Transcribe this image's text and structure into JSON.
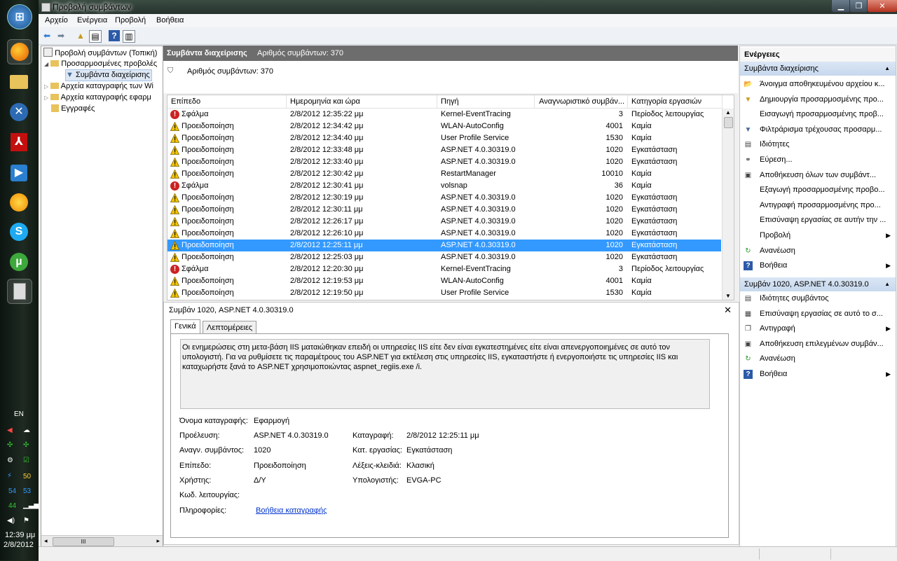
{
  "window": {
    "title": "Προβολή συμβάντων"
  },
  "menu": [
    "Αρχείο",
    "Ενέργεια",
    "Προβολή",
    "Βοήθεια"
  ],
  "tree": {
    "items": [
      {
        "label": "Προβολή συμβάντων (Τοπική)"
      },
      {
        "label": "Προσαρμοσμένες προβολές"
      },
      {
        "label": "Συμβάντα διαχείρισης"
      },
      {
        "label": "Αρχεία καταγραφής των Wi"
      },
      {
        "label": "Αρχεία καταγραφής εφαρμ"
      },
      {
        "label": "Εγγραφές"
      }
    ],
    "scroll_glyph": "III"
  },
  "center": {
    "header_title": "Συμβάντα διαχείρισης",
    "header_count": "Αριθμός συμβάντων: 370",
    "filter_count": "Αριθμός συμβάντων: 370",
    "columns": [
      "Επίπεδο",
      "Ημερομηνία και ώρα",
      "Πηγή",
      "Αναγνωριστικό συμβάν...",
      "Κατηγορία εργασιών"
    ],
    "rows": [
      {
        "level": "Σφάλμα",
        "type": "error",
        "date": "2/8/2012 12:35:22 μμ",
        "source": "Kernel-EventTracing",
        "id": "3",
        "category": "Περίοδος λειτουργίας"
      },
      {
        "level": "Προειδοποίηση",
        "type": "warning",
        "date": "2/8/2012 12:34:42 μμ",
        "source": "WLAN-AutoConfig",
        "id": "4001",
        "category": "Καμία"
      },
      {
        "level": "Προειδοποίηση",
        "type": "warning",
        "date": "2/8/2012 12:34:40 μμ",
        "source": "User Profile Service",
        "id": "1530",
        "category": "Καμία"
      },
      {
        "level": "Προειδοποίηση",
        "type": "warning",
        "date": "2/8/2012 12:33:48 μμ",
        "source": "ASP.NET 4.0.30319.0",
        "id": "1020",
        "category": "Εγκατάσταση"
      },
      {
        "level": "Προειδοποίηση",
        "type": "warning",
        "date": "2/8/2012 12:33:40 μμ",
        "source": "ASP.NET 4.0.30319.0",
        "id": "1020",
        "category": "Εγκατάσταση"
      },
      {
        "level": "Προειδοποίηση",
        "type": "warning",
        "date": "2/8/2012 12:30:42 μμ",
        "source": "RestartManager",
        "id": "10010",
        "category": "Καμία"
      },
      {
        "level": "Σφάλμα",
        "type": "error",
        "date": "2/8/2012 12:30:41 μμ",
        "source": "volsnap",
        "id": "36",
        "category": "Καμία"
      },
      {
        "level": "Προειδοποίηση",
        "type": "warning",
        "date": "2/8/2012 12:30:19 μμ",
        "source": "ASP.NET 4.0.30319.0",
        "id": "1020",
        "category": "Εγκατάσταση"
      },
      {
        "level": "Προειδοποίηση",
        "type": "warning",
        "date": "2/8/2012 12:30:11 μμ",
        "source": "ASP.NET 4.0.30319.0",
        "id": "1020",
        "category": "Εγκατάσταση"
      },
      {
        "level": "Προειδοποίηση",
        "type": "warning",
        "date": "2/8/2012 12:26:17 μμ",
        "source": "ASP.NET 4.0.30319.0",
        "id": "1020",
        "category": "Εγκατάσταση"
      },
      {
        "level": "Προειδοποίηση",
        "type": "warning",
        "date": "2/8/2012 12:26:10 μμ",
        "source": "ASP.NET 4.0.30319.0",
        "id": "1020",
        "category": "Εγκατάσταση"
      },
      {
        "level": "Προειδοποίηση",
        "type": "warning",
        "date": "2/8/2012 12:25:11 μμ",
        "source": "ASP.NET 4.0.30319.0",
        "id": "1020",
        "category": "Εγκατάσταση",
        "selected": true
      },
      {
        "level": "Προειδοποίηση",
        "type": "warning",
        "date": "2/8/2012 12:25:03 μμ",
        "source": "ASP.NET 4.0.30319.0",
        "id": "1020",
        "category": "Εγκατάσταση"
      },
      {
        "level": "Σφάλμα",
        "type": "error",
        "date": "2/8/2012 12:20:30 μμ",
        "source": "Kernel-EventTracing",
        "id": "3",
        "category": "Περίοδος λειτουργίας"
      },
      {
        "level": "Προειδοποίηση",
        "type": "warning",
        "date": "2/8/2012 12:19:53 μμ",
        "source": "WLAN-AutoConfig",
        "id": "4001",
        "category": "Καμία"
      },
      {
        "level": "Προειδοποίηση",
        "type": "warning",
        "date": "2/8/2012 12:19:50 μμ",
        "source": "User Profile Service",
        "id": "1530",
        "category": "Καμία"
      }
    ]
  },
  "detail": {
    "title": "Συμβάν 1020, ASP.NET 4.0.30319.0",
    "tabs": [
      "Γενικά",
      "Λεπτομέρειες"
    ],
    "description": "Οι ενημερώσεις στη μετα-βάση IIS ματαιώθηκαν επειδή οι υπηρεσίες IIS είτε δεν είναι εγκατεστημένες είτε είναι απενεργοποιημένες σε αυτό τον υπολογιστή. Για να ρυθμίσετε τις παραμέτρους του ASP.NET για εκτέλεση στις υπηρεσίες IIS, εγκαταστήστε ή ενεργοποιήστε τις υπηρεσίες IIS και καταχωρήστε ξανά το ASP.NET χρησιμοποιώντας aspnet_regiis.exe /i.",
    "fields": {
      "log_name_label": "Όνομα καταγραφής:",
      "log_name": "Εφαρμογή",
      "source_label": "Προέλευση:",
      "source": "ASP.NET 4.0.30319.0",
      "logged_label": "Καταγραφή:",
      "logged": "2/8/2012 12:25:11 μμ",
      "event_id_label": "Αναγν. συμβάντος:",
      "event_id": "1020",
      "task_label": "Κατ. εργασίας:",
      "task": "Εγκατάσταση",
      "level_label": "Επίπεδο:",
      "level": "Προειδοποίηση",
      "keywords_label": "Λέξεις-κλειδιά:",
      "keywords": "Κλασική",
      "user_label": "Χρήστης:",
      "user": "Δ/Υ",
      "computer_label": "Υπολογιστής:",
      "computer": "EVGA-PC",
      "opcode_label": "Κωδ. λειτουργίας:",
      "info_label": "Πληροφορίες:",
      "info_link": "Βοήθεια καταγραφής"
    }
  },
  "actions": {
    "header": "Ενέργειες",
    "section1": "Συμβάντα διαχείρισης",
    "items1": [
      {
        "label": "Άνοιγμα αποθηκευμένου αρχείου κ...",
        "icon": "open-folder-icon",
        "glyph": "📂"
      },
      {
        "label": "Δημιουργία προσαρμοσμένης προ...",
        "icon": "filter-create-icon",
        "glyph": "▼"
      },
      {
        "label": "Εισαγωγή προσαρμοσμένης προβ...",
        "icon": "",
        "glyph": ""
      },
      {
        "label": "Φιλτράρισμα τρέχουσας προσαρμ...",
        "icon": "filter-icon",
        "glyph": "▼"
      },
      {
        "label": "Ιδιότητες",
        "icon": "properties-icon",
        "glyph": "▤"
      },
      {
        "label": "Εύρεση...",
        "icon": "binoculars-icon",
        "glyph": "⚭"
      },
      {
        "label": "Αποθήκευση όλων των συμβάντ...",
        "icon": "save-icon",
        "glyph": "▣"
      },
      {
        "label": "Εξαγωγή προσαρμοσμένης προβο...",
        "icon": "",
        "glyph": ""
      },
      {
        "label": "Αντιγραφή προσαρμοσμένης προ...",
        "icon": "",
        "glyph": ""
      },
      {
        "label": "Επισύναψη εργασίας σε αυτήν την ...",
        "icon": "",
        "glyph": ""
      },
      {
        "label": "Προβολή",
        "icon": "",
        "glyph": "",
        "submenu": true
      },
      {
        "label": "Ανανέωση",
        "icon": "refresh-icon",
        "glyph": "↻"
      },
      {
        "label": "Βοήθεια",
        "icon": "help-icon",
        "glyph": "?",
        "submenu": true
      }
    ],
    "section2": "Συμβάν 1020, ASP.NET 4.0.30319.0",
    "items2": [
      {
        "label": "Ιδιότητες συμβάντος",
        "icon": "event-properties-icon",
        "glyph": "▤"
      },
      {
        "label": "Επισύναψη εργασίας σε αυτό το σ...",
        "icon": "attach-task-icon",
        "glyph": "▦"
      },
      {
        "label": "Αντιγραφή",
        "icon": "copy-icon",
        "glyph": "❐",
        "submenu": true
      },
      {
        "label": "Αποθήκευση επιλεγμένων συμβάν...",
        "icon": "save-icon",
        "glyph": "▣"
      },
      {
        "label": "Ανανέωση",
        "icon": "refresh-icon",
        "glyph": "↻"
      },
      {
        "label": "Βοήθεια",
        "icon": "help-icon",
        "glyph": "?",
        "submenu": true
      }
    ]
  },
  "taskbar": {
    "lang": "EN",
    "clock_time": "12:39 μμ",
    "clock_date": "2/8/2012",
    "tray_values": [
      "50",
      "54",
      "53",
      "44"
    ]
  },
  "colors": {
    "selection": "#3399ff",
    "error": "#cc2222",
    "warning": "#f2c300",
    "link": "#0033cc"
  }
}
